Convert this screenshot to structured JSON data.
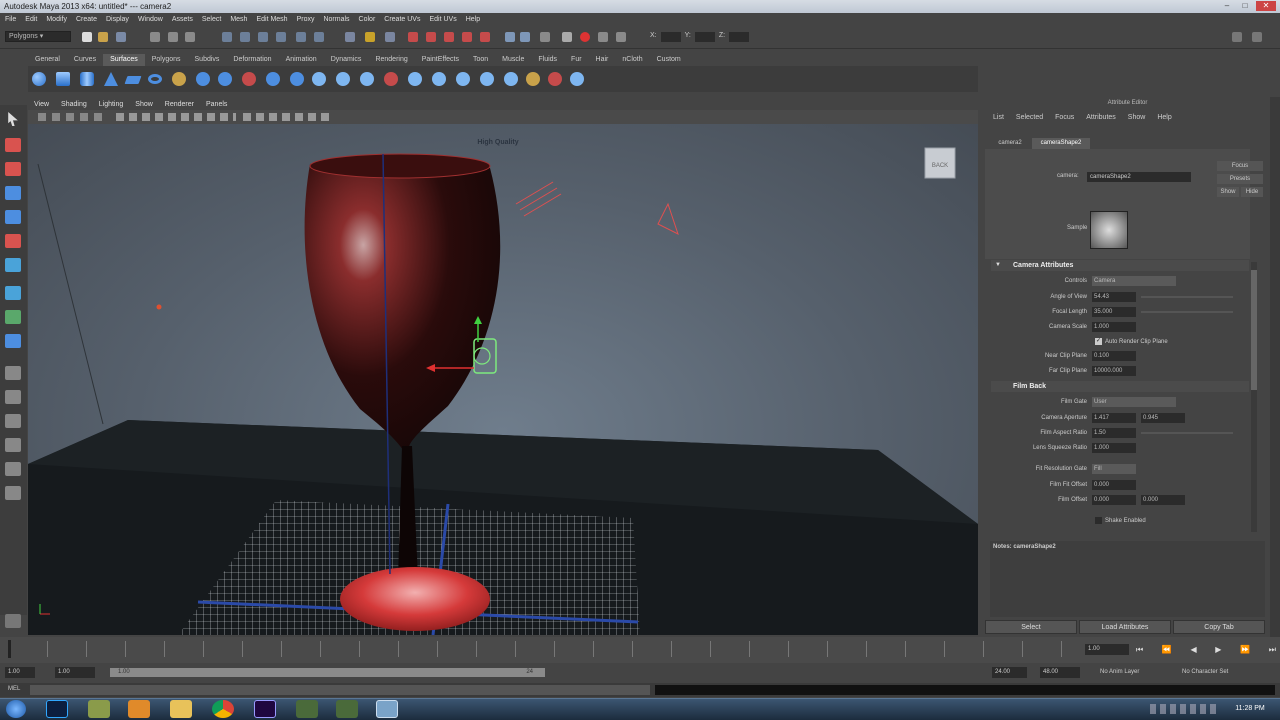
{
  "window": {
    "title": "Autodesk Maya 2013 x64: untitled*   ---   camera2"
  },
  "menubar": [
    "File",
    "Edit",
    "Modify",
    "Create",
    "Display",
    "Window",
    "Assets",
    "Select",
    "Mesh",
    "Edit Mesh",
    "Proxy",
    "Normals",
    "Color",
    "Create UVs",
    "Edit UVs",
    "Help"
  ],
  "status": {
    "mode": "Polygons",
    "xyz_labels": [
      "X:",
      "Y:",
      "Z:"
    ]
  },
  "shelf_tabs": [
    "General",
    "Curves",
    "Surfaces",
    "Polygons",
    "Subdivs",
    "Deformation",
    "Animation",
    "Dynamics",
    "Rendering",
    "PaintEffects",
    "Toon",
    "Muscle",
    "Fluids",
    "Fur",
    "Hair",
    "nCloth",
    "Custom"
  ],
  "shelf_active": "Surfaces",
  "viewport": {
    "menu": [
      "View",
      "Shading",
      "Lighting",
      "Show",
      "Renderer",
      "Panels"
    ],
    "hq_label": "High Quality",
    "viewcube_label": "BACK"
  },
  "attribute_editor": {
    "title": "Attribute Editor",
    "menu": [
      "List",
      "Selected",
      "Focus",
      "Attributes",
      "Show",
      "Help"
    ],
    "tabs": [
      "camera2",
      "cameraShape2"
    ],
    "active_tab": "cameraShape2",
    "node_label": "camera:",
    "node_value": "cameraShape2",
    "side_buttons": [
      "Focus",
      "Presets",
      "Show",
      "Hide"
    ],
    "sample_label": "Sample",
    "sections": {
      "camera_attributes": "Camera Attributes",
      "film_back": "Film Back"
    },
    "camera_rows": [
      {
        "label": "Controls",
        "value": "Camera"
      },
      {
        "label": "Angle of View",
        "value": "54.43"
      },
      {
        "label": "Focal Length",
        "value": "35.000"
      },
      {
        "label": "Camera Scale",
        "value": "1.000"
      },
      {
        "label": "",
        "value": "Auto Render Clip Plane"
      },
      {
        "label": "Near Clip Plane",
        "value": "0.100"
      },
      {
        "label": "Far Clip Plane",
        "value": "10000.000"
      }
    ],
    "film_rows": [
      {
        "label": "Film Gate",
        "value": "User"
      },
      {
        "label": "Camera Aperture",
        "value": "1.417",
        "value2": "0.945"
      },
      {
        "label": "Film Aspect Ratio",
        "value": "1.50"
      },
      {
        "label": "Lens Squeeze Ratio",
        "value": "1.000"
      },
      {
        "label": "Fit Resolution Gate",
        "value": "Fill"
      },
      {
        "label": "Film Fit Offset",
        "value": "0.000"
      },
      {
        "label": "Film Offset",
        "value": "0.000",
        "value2": "0.000"
      },
      {
        "label": "",
        "value": "Shake Enabled"
      }
    ],
    "notes": "Notes: cameraShape2",
    "bottom_buttons": [
      "Select",
      "Load Attributes",
      "Copy Tab"
    ]
  },
  "timeline": {
    "current_frame": "1.00",
    "range": {
      "start": "1.00",
      "inner_start": "1.00",
      "inner_end": "24",
      "end_a": "24.00",
      "end_b": "48.00"
    },
    "anim_layer": "No Anim Layer",
    "char_set": "No Character Set",
    "cmd_label": "MEL"
  },
  "taskbar": {
    "clock": "11:28 PM",
    "apps": [
      "start-orb",
      "photoshop",
      "file-manager",
      "media-player",
      "folder",
      "chrome",
      "after-effects",
      "tool-a",
      "tool-b",
      "maya"
    ]
  },
  "colors": {
    "accent": "#5a7bb3",
    "glass_red": "#b62424",
    "panel": "#444444"
  }
}
